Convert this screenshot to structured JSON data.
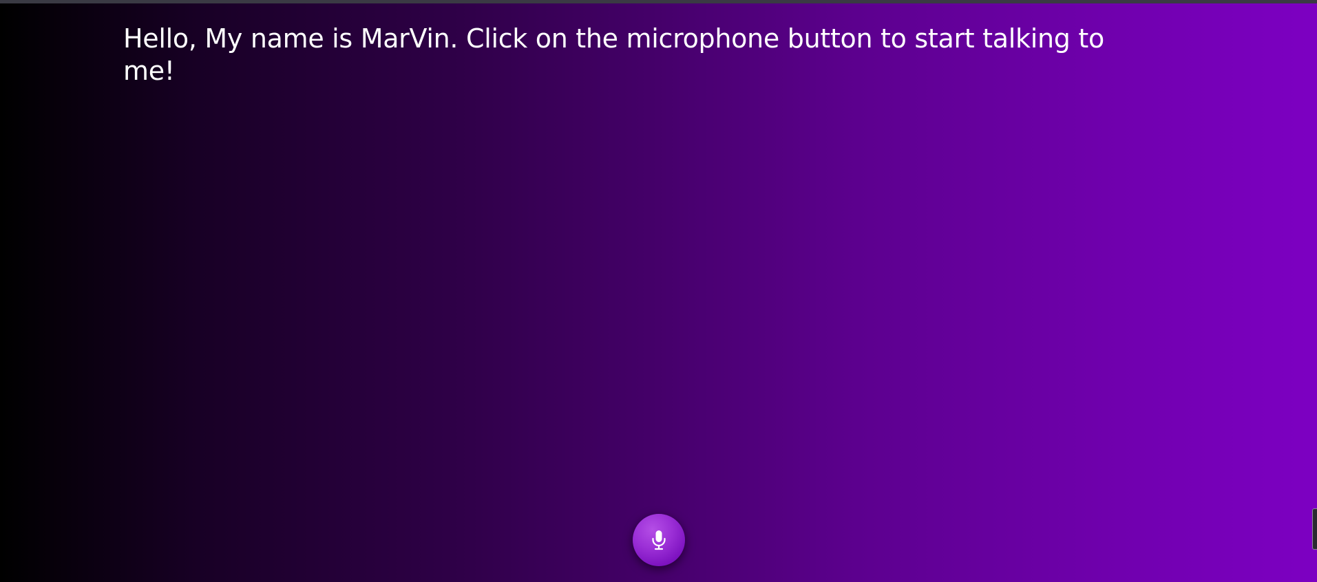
{
  "greeting": {
    "text": "Hello, My name is MarVin. Click on the microphone button to start talking to me!"
  },
  "mic_button": {
    "icon": "microphone-icon"
  },
  "colors": {
    "gradient_start": "#000000",
    "gradient_end": "#7d00c2",
    "text": "#ffffff",
    "button": "#9b2fd6"
  }
}
